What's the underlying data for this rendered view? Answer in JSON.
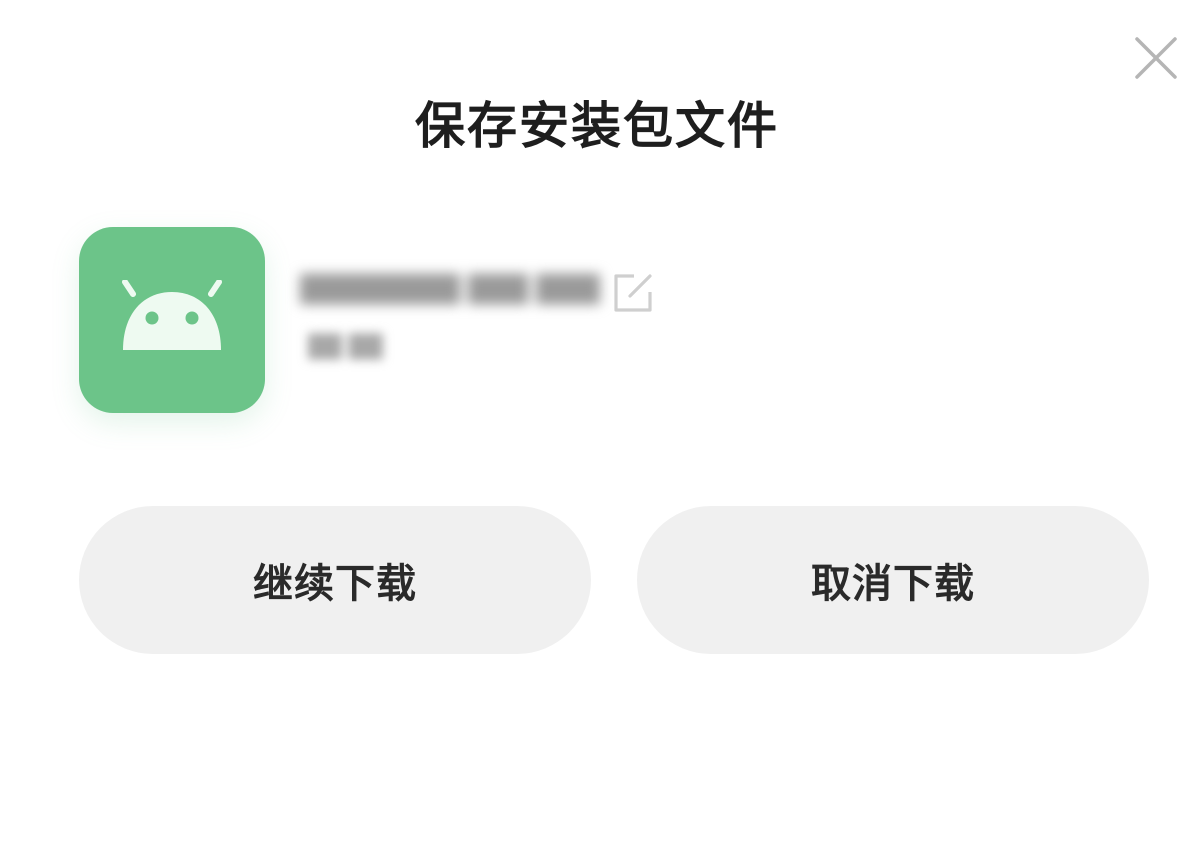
{
  "dialog": {
    "title": "保存安装包文件",
    "close_icon": "close-icon",
    "app": {
      "icon": "android-icon",
      "icon_color": "#6cc489",
      "file_name": "████████ ███ ████",
      "file_size": "██ ██",
      "edit_icon": "edit-icon"
    },
    "buttons": {
      "continue_label": "继续下载",
      "cancel_label": "取消下载"
    }
  }
}
